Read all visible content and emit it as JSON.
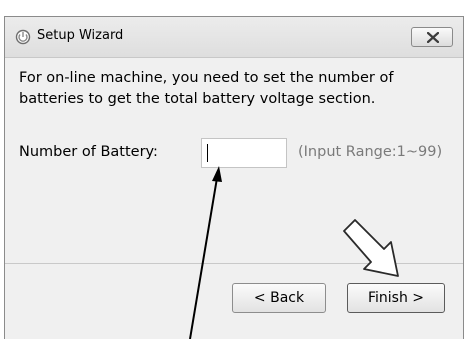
{
  "window": {
    "title": "Setup Wizard",
    "app_icon": "power-icon",
    "close_icon": "close-icon"
  },
  "content": {
    "instruction": "For on-line machine, you need to set the number of batteries to get the total battery voltage section.",
    "field_label": "Number of Battery:",
    "field_value": "",
    "range_hint": "(Input Range:1~99)"
  },
  "buttons": {
    "back_label": "< Back",
    "finish_label": "Finish >"
  },
  "annotations": {
    "arrow_to_input": "arrow-icon",
    "arrow_to_finish": "hollow-arrow-icon"
  }
}
